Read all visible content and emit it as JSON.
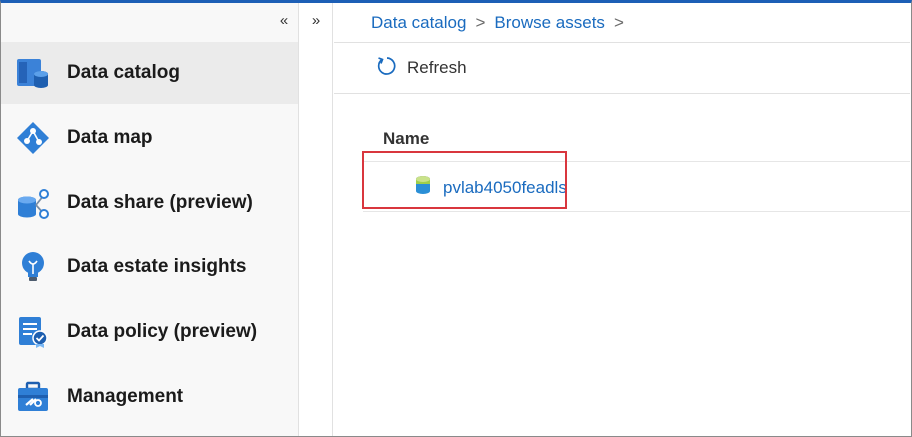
{
  "sidebar": {
    "collapse_glyph": "«",
    "items": [
      {
        "label": "Data catalog",
        "icon": "data-catalog-icon",
        "active": true
      },
      {
        "label": "Data map",
        "icon": "data-map-icon"
      },
      {
        "label": "Data share (preview)",
        "icon": "data-share-icon"
      },
      {
        "label": "Data estate insights",
        "icon": "lightbulb-icon"
      },
      {
        "label": "Data policy (preview)",
        "icon": "data-policy-icon"
      },
      {
        "label": "Management",
        "icon": "toolbox-icon"
      }
    ]
  },
  "expand_glyph": "»",
  "breadcrumb": {
    "items": [
      "Data catalog",
      "Browse assets"
    ],
    "separator": ">"
  },
  "toolbar": {
    "refresh_label": "Refresh"
  },
  "table": {
    "column_header": "Name",
    "rows": [
      {
        "name": "pvlab4050feadls",
        "icon": "data-lake-storage-icon"
      }
    ]
  },
  "colors": {
    "accent": "#1a6bbf",
    "highlight": "#d9363e",
    "top_bar": "#1d5fb6"
  }
}
